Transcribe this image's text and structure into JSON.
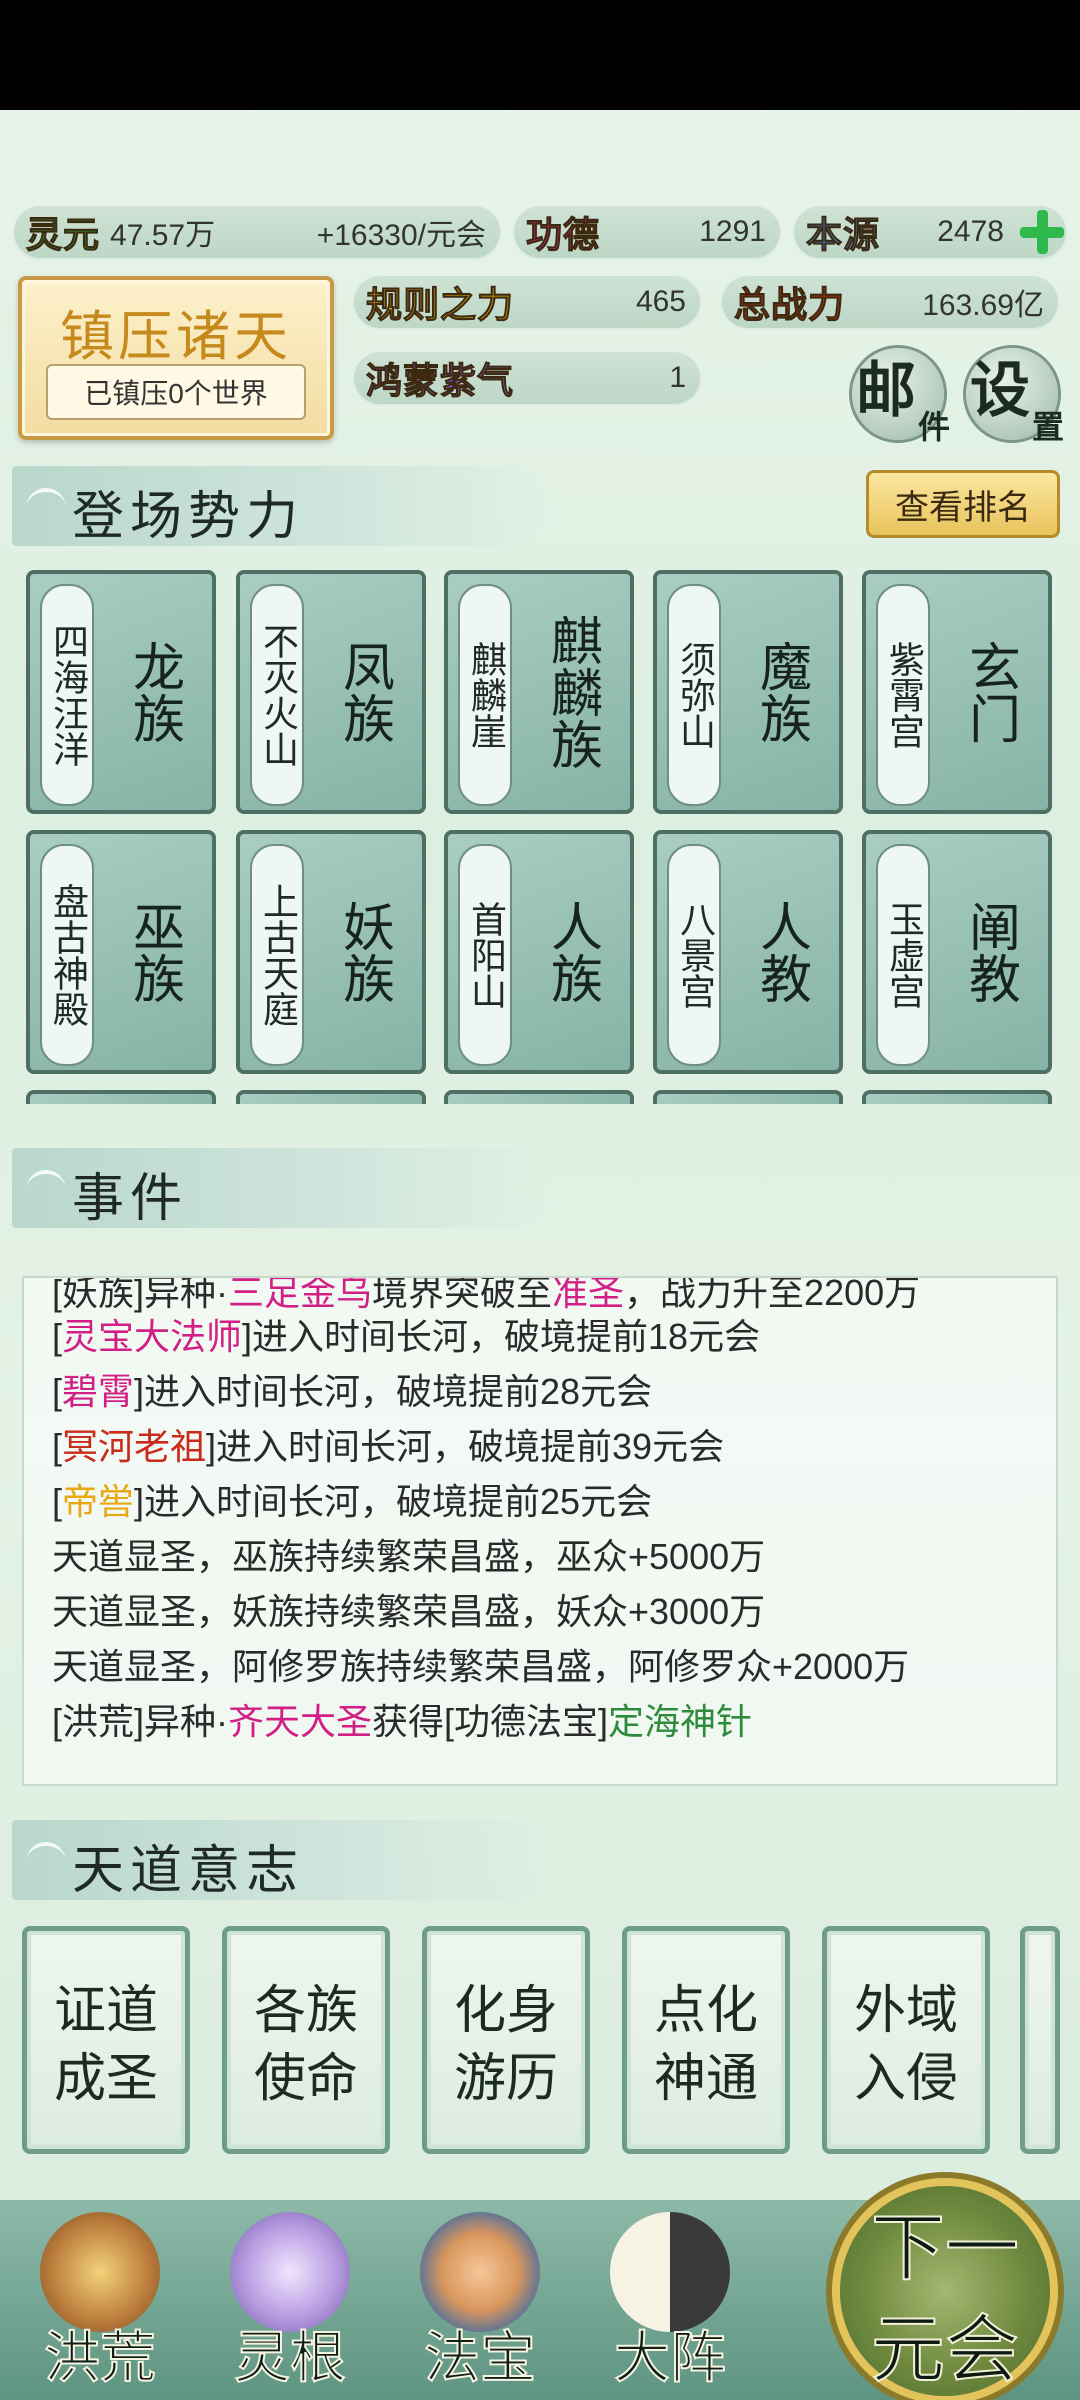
{
  "resources": {
    "lingyuan": {
      "label": "灵元",
      "value": "47.57万",
      "rate": "+16330/元会"
    },
    "gongde": {
      "label": "功德",
      "value": "1291"
    },
    "benyuan": {
      "label": "本源",
      "value": "2478"
    },
    "guize": {
      "label": "规则之力",
      "value": "465"
    },
    "zongzhanli": {
      "label": "总战力",
      "value": "163.69亿"
    },
    "hongmeng": {
      "label": "鸿蒙紫气",
      "value": "1"
    }
  },
  "seal": {
    "title": "镇压诸天",
    "subtitle": "已镇压0个世界"
  },
  "buttons": {
    "mail": {
      "big": "邮",
      "small": "件"
    },
    "settings": {
      "big": "设",
      "small": "置"
    },
    "rank": "查看排名"
  },
  "sections": {
    "factions": "登场势力",
    "events": "事件",
    "tiandao": "天道意志"
  },
  "factions": [
    {
      "place": "四海汪洋",
      "name": "龙族"
    },
    {
      "place": "不灭火山",
      "name": "凤族"
    },
    {
      "place": "麒麟崖",
      "name": "麒麟族"
    },
    {
      "place": "须弥山",
      "name": "魔族"
    },
    {
      "place": "紫霄宫",
      "name": "玄门"
    },
    {
      "place": "盘古神殿",
      "name": "巫族"
    },
    {
      "place": "上古天庭",
      "name": "妖族"
    },
    {
      "place": "首阳山",
      "name": "人族"
    },
    {
      "place": "八景宫",
      "name": "人教"
    },
    {
      "place": "玉虚宫",
      "name": "阐教"
    }
  ],
  "events": [
    {
      "pre": "[妖族]异种·",
      "hl": "三足金乌",
      "mid": "境界突破至",
      "hl2": "准圣",
      "post": "，战力升至2200万"
    },
    {
      "pre": "[",
      "hl": "灵宝大法师",
      "post": "]进入时间长河，破境提前18元会"
    },
    {
      "pre": "[",
      "hl": "碧霄",
      "post": "]进入时间长河，破境提前28元会"
    },
    {
      "pre": "[",
      "hl": "冥河老祖",
      "post": "]进入时间长河，破境提前39元会"
    },
    {
      "pre": "[",
      "hl": "帝喾",
      "post": "]进入时间长河，破境提前25元会"
    },
    {
      "text": "天道显圣，巫族持续繁荣昌盛，巫众+5000万"
    },
    {
      "text": "天道显圣，妖族持续繁荣昌盛，妖众+3000万"
    },
    {
      "text": "天道显圣，阿修罗族持续繁荣昌盛，阿修罗众+2000万"
    },
    {
      "pre": "[洪荒]异种·",
      "hl": "齐天大圣",
      "mid": "获得[功德法宝]",
      "hl2": "定海神针"
    }
  ],
  "tiandao": [
    {
      "l1": "证道",
      "l2": "成圣"
    },
    {
      "l1": "各族",
      "l2": "使命"
    },
    {
      "l1": "化身",
      "l2": "游历"
    },
    {
      "l1": "点化",
      "l2": "神通"
    },
    {
      "l1": "外域",
      "l2": "入侵"
    }
  ],
  "nav": [
    "洪荒",
    "灵根",
    "法宝",
    "大阵"
  ],
  "next": {
    "l1": "下一",
    "l2": "元会"
  }
}
